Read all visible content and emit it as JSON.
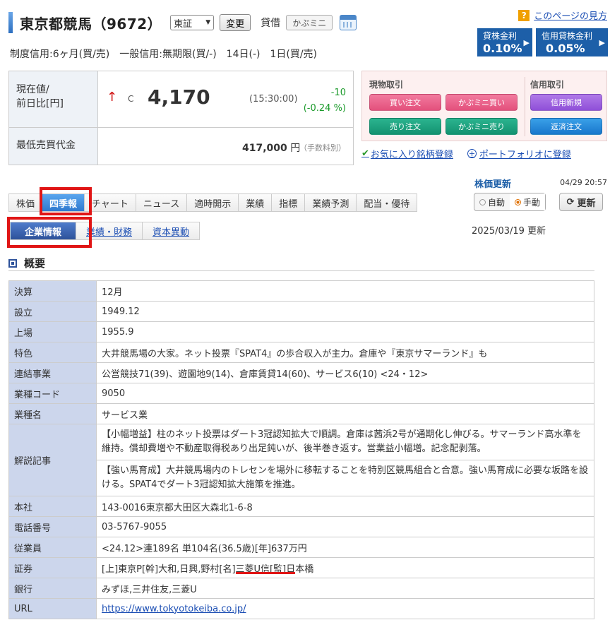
{
  "header": {
    "company": "東京都競馬（9672）",
    "market": "東証",
    "change_button": "変更",
    "lend_label": "貸借",
    "kabumini_badge": "かぶミニ",
    "help_link": "このページの見方",
    "credit_line": "制度信用:6ヶ月(買/売)　一般信用:無期限(買/-)　14日(-)　1日(買/売)"
  },
  "rates": {
    "lend_label": "貸株金利",
    "lend_value": "0.10%",
    "credit_label": "信用貸株金利",
    "credit_value": "0.05%"
  },
  "price": {
    "label_line1": "現在値/",
    "label_line2": "前日比[円]",
    "arrow": "↑",
    "c_mark": "C",
    "value": "4,170",
    "time": "(15:30:00)",
    "change": "-10",
    "change_pct": "(-0.24 %)",
    "min_label": "最低売買代金",
    "min_value": "417,000",
    "min_unit": " 円",
    "fee_note": "（手数料別）"
  },
  "trade": {
    "genbutsu_label": "現物取引",
    "shinyo_label": "信用取引",
    "buy": "買い注文",
    "kabumini_buy": "かぶミニ買い",
    "sell": "売り注文",
    "kabumini_sell": "かぶミニ売り",
    "credit_new": "信用新規",
    "repay": "返済注文"
  },
  "links": {
    "favorite": "お気に入り銘柄登録",
    "portfolio": "ポートフォリオに登録"
  },
  "price_update": {
    "label": "株価更新",
    "time": "04/29 20:57",
    "auto": "自動",
    "manual": "手動",
    "refresh": "更新"
  },
  "tabs": [
    "株価",
    "四季報",
    "チャート",
    "ニュース",
    "適時開示",
    "業績",
    "指標",
    "業績予測",
    "配当・優待"
  ],
  "subtabs": [
    "企業情報",
    "業績・財務",
    "資本異動"
  ],
  "update_date": "2025/03/19 更新",
  "overview": {
    "title": "概要",
    "rows": [
      {
        "k": "決算",
        "v": "12月"
      },
      {
        "k": "設立",
        "v": "1949.12"
      },
      {
        "k": "上場",
        "v": "1955.9"
      },
      {
        "k": "特色",
        "v": "大井競馬場の大家。ネット投票『SPAT4』の歩合収入が主力。倉庫や『東京サマーランド』も"
      },
      {
        "k": "連結事業",
        "v": "公営競技71(39)、遊園地9(14)、倉庫賃貸14(60)、サービス6(10) <24・12>"
      },
      {
        "k": "業種コード",
        "v": "9050"
      },
      {
        "k": "業種名",
        "v": "サービス業"
      },
      {
        "k": "解説記事",
        "v": "【小幅増益】柱のネット投票はダート3冠認知拡大で順調。倉庫は茜浜2号が通期化し伸びる。サマーランド高水準を維持。償却費増や不動産取得税あり出足鈍いが、後半巻き返す。営業益小幅増。記念配剥落。",
        "v2": "【強い馬育成】大井競馬場内のトレセンを場外に移転することを特別区競馬組合と合意。強い馬育成に必要な坂路を設ける。SPAT4でダート3冠認知拡大施策を推進。"
      },
      {
        "k": "本社",
        "v": "143-0016東京都大田区大森北1-6-8"
      },
      {
        "k": "電話番号",
        "v": "03-5767-9055"
      },
      {
        "k": "従業員",
        "v": "<24.12>連189名 単104名(36.5歳)[年]637万円"
      },
      {
        "k": "証券",
        "v": "[上]東京P[幹]大和,日興,野村[名]三菱U信[監]日本橋"
      },
      {
        "k": "銀行",
        "v": "みずほ,三井住友,三菱U"
      },
      {
        "k": "URL",
        "v": "https://www.tokyotokeiba.co.jp/"
      }
    ]
  }
}
